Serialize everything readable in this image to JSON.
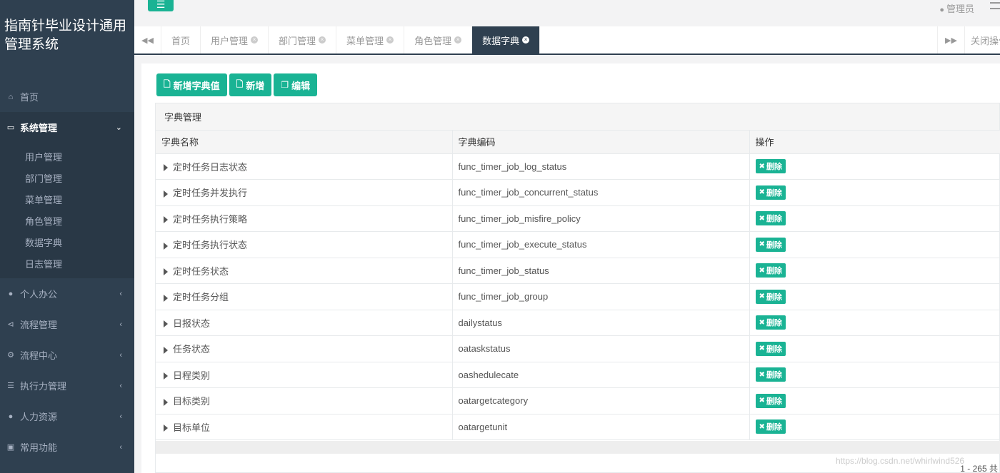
{
  "brand": {
    "title": "指南针毕业设计通用管理系统"
  },
  "sidebar": {
    "home": {
      "label": "首页",
      "icon": "home-icon"
    },
    "system": {
      "label": "系统管理",
      "icon": "monitor-icon",
      "children": [
        "用户管理",
        "部门管理",
        "菜单管理",
        "角色管理",
        "数据字典",
        "日志管理"
      ]
    },
    "groups": [
      {
        "label": "个人办公",
        "icon": "user-icon"
      },
      {
        "label": "流程管理",
        "icon": "share-icon"
      },
      {
        "label": "流程中心",
        "icon": "gear-icon"
      },
      {
        "label": "执行力管理",
        "icon": "list-icon"
      },
      {
        "label": "人力资源",
        "icon": "users-icon"
      },
      {
        "label": "常用功能",
        "icon": "cubes-icon"
      }
    ]
  },
  "topbar": {
    "user": "管理员",
    "menu_icon": "hamburger-icon"
  },
  "tabs": {
    "items": [
      {
        "label": "首页",
        "closable": false
      },
      {
        "label": "用户管理",
        "closable": true
      },
      {
        "label": "部门管理",
        "closable": true
      },
      {
        "label": "菜单管理",
        "closable": true
      },
      {
        "label": "角色管理",
        "closable": true
      },
      {
        "label": "数据字典",
        "closable": true,
        "active": true
      }
    ],
    "close_ops": "关闭操作"
  },
  "toolbar": {
    "add_value": "新增字典值",
    "add": "新增",
    "edit": "编辑"
  },
  "panel": {
    "title": "字典管理",
    "columns": [
      "字典名称",
      "字典编码",
      "操作"
    ],
    "delete_label": "删除",
    "rows": [
      {
        "name": "定时任务日志状态",
        "code": "func_timer_job_log_status"
      },
      {
        "name": "定时任务并发执行",
        "code": "func_timer_job_concurrent_status"
      },
      {
        "name": "定时任务执行策略",
        "code": "func_timer_job_misfire_policy"
      },
      {
        "name": "定时任务执行状态",
        "code": "func_timer_job_execute_status"
      },
      {
        "name": "定时任务状态",
        "code": "func_timer_job_status"
      },
      {
        "name": "定时任务分组",
        "code": "func_timer_job_group"
      },
      {
        "name": "日报状态",
        "code": "dailystatus"
      },
      {
        "name": "任务状态",
        "code": "oataskstatus"
      },
      {
        "name": "日程类别",
        "code": "oashedulecate"
      },
      {
        "name": "目标类别",
        "code": "oatargetcategory"
      },
      {
        "name": "目标单位",
        "code": "oatargetunit"
      }
    ],
    "pager": "1 - 265  共"
  },
  "watermark": "https://blog.csdn.net/whirlwind526"
}
